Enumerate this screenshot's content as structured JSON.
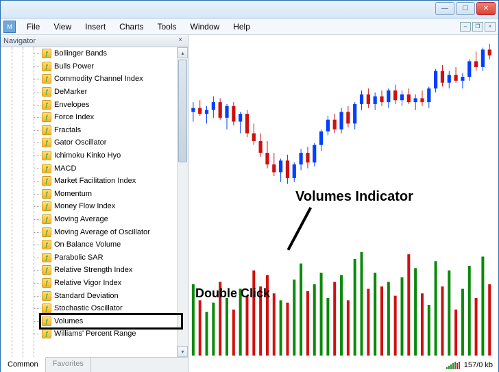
{
  "window": {
    "title": ""
  },
  "menubar": {
    "items": [
      "File",
      "View",
      "Insert",
      "Charts",
      "Tools",
      "Window",
      "Help"
    ]
  },
  "navigator": {
    "title": "Navigator",
    "tabs": {
      "common": "Common",
      "favorites": "Favorites"
    },
    "items": [
      "Bollinger Bands",
      "Bulls Power",
      "Commodity Channel Index",
      "DeMarker",
      "Envelopes",
      "Force Index",
      "Fractals",
      "Gator Oscillator",
      "Ichimoku Kinko Hyo",
      "MACD",
      "Market Facilitation Index",
      "Momentum",
      "Money Flow Index",
      "Moving Average",
      "Moving Average of Oscillator",
      "On Balance Volume",
      "Parabolic SAR",
      "Relative Strength Index",
      "Relative Vigor Index",
      "Standard Deviation",
      "Stochastic Oscillator",
      "Volumes",
      "Williams' Percent Range"
    ],
    "highlighted_item": "Volumes"
  },
  "annotations": {
    "volumes_indicator": "Volumes Indicator",
    "double_click": "Double Click"
  },
  "statusbar": {
    "kb": "157/0 kb"
  },
  "chart_data": {
    "type": "candlestick+bar",
    "candles_y_range": [
      0,
      190
    ],
    "candles": [
      {
        "o": 118,
        "h": 128,
        "l": 108,
        "c": 122,
        "up": true
      },
      {
        "o": 122,
        "h": 130,
        "l": 114,
        "c": 116,
        "up": false
      },
      {
        "o": 116,
        "h": 124,
        "l": 106,
        "c": 120,
        "up": true
      },
      {
        "o": 120,
        "h": 134,
        "l": 112,
        "c": 128,
        "up": true
      },
      {
        "o": 128,
        "h": 132,
        "l": 110,
        "c": 112,
        "up": false
      },
      {
        "o": 112,
        "h": 126,
        "l": 100,
        "c": 124,
        "up": true
      },
      {
        "o": 124,
        "h": 128,
        "l": 104,
        "c": 108,
        "up": false
      },
      {
        "o": 108,
        "h": 118,
        "l": 96,
        "c": 116,
        "up": true
      },
      {
        "o": 116,
        "h": 120,
        "l": 92,
        "c": 96,
        "up": false
      },
      {
        "o": 96,
        "h": 106,
        "l": 84,
        "c": 88,
        "up": false
      },
      {
        "o": 88,
        "h": 96,
        "l": 72,
        "c": 76,
        "up": false
      },
      {
        "o": 76,
        "h": 88,
        "l": 60,
        "c": 64,
        "up": false
      },
      {
        "o": 64,
        "h": 76,
        "l": 52,
        "c": 56,
        "up": false
      },
      {
        "o": 56,
        "h": 70,
        "l": 46,
        "c": 68,
        "up": true
      },
      {
        "o": 68,
        "h": 74,
        "l": 44,
        "c": 50,
        "up": false
      },
      {
        "o": 50,
        "h": 66,
        "l": 46,
        "c": 64,
        "up": true
      },
      {
        "o": 64,
        "h": 80,
        "l": 58,
        "c": 76,
        "up": true
      },
      {
        "o": 76,
        "h": 82,
        "l": 60,
        "c": 66,
        "up": false
      },
      {
        "o": 66,
        "h": 86,
        "l": 62,
        "c": 84,
        "up": true
      },
      {
        "o": 84,
        "h": 100,
        "l": 78,
        "c": 98,
        "up": true
      },
      {
        "o": 98,
        "h": 114,
        "l": 94,
        "c": 110,
        "up": true
      },
      {
        "o": 110,
        "h": 116,
        "l": 96,
        "c": 100,
        "up": false
      },
      {
        "o": 100,
        "h": 122,
        "l": 96,
        "c": 118,
        "up": true
      },
      {
        "o": 118,
        "h": 124,
        "l": 102,
        "c": 106,
        "up": false
      },
      {
        "o": 106,
        "h": 128,
        "l": 100,
        "c": 126,
        "up": true
      },
      {
        "o": 126,
        "h": 140,
        "l": 120,
        "c": 136,
        "up": true
      },
      {
        "o": 136,
        "h": 142,
        "l": 122,
        "c": 126,
        "up": false
      },
      {
        "o": 126,
        "h": 138,
        "l": 120,
        "c": 134,
        "up": true
      },
      {
        "o": 134,
        "h": 140,
        "l": 124,
        "c": 128,
        "up": false
      },
      {
        "o": 128,
        "h": 142,
        "l": 122,
        "c": 140,
        "up": true
      },
      {
        "o": 140,
        "h": 146,
        "l": 126,
        "c": 130,
        "up": false
      },
      {
        "o": 130,
        "h": 140,
        "l": 124,
        "c": 136,
        "up": true
      },
      {
        "o": 136,
        "h": 142,
        "l": 126,
        "c": 128,
        "up": false
      },
      {
        "o": 128,
        "h": 136,
        "l": 120,
        "c": 132,
        "up": true
      },
      {
        "o": 132,
        "h": 140,
        "l": 124,
        "c": 128,
        "up": false
      },
      {
        "o": 128,
        "h": 144,
        "l": 122,
        "c": 142,
        "up": true
      },
      {
        "o": 142,
        "h": 162,
        "l": 138,
        "c": 160,
        "up": true
      },
      {
        "o": 160,
        "h": 166,
        "l": 144,
        "c": 148,
        "up": false
      },
      {
        "o": 148,
        "h": 160,
        "l": 142,
        "c": 156,
        "up": true
      },
      {
        "o": 156,
        "h": 164,
        "l": 148,
        "c": 150,
        "up": false
      },
      {
        "o": 150,
        "h": 158,
        "l": 142,
        "c": 154,
        "up": true
      },
      {
        "o": 154,
        "h": 172,
        "l": 150,
        "c": 170,
        "up": true
      },
      {
        "o": 170,
        "h": 180,
        "l": 160,
        "c": 164,
        "up": false
      },
      {
        "o": 164,
        "h": 184,
        "l": 160,
        "c": 182,
        "up": true
      },
      {
        "o": 182,
        "h": 188,
        "l": 172,
        "c": 176,
        "up": false
      }
    ],
    "volumes_y_range": [
      0,
      100
    ],
    "volumes": [
      {
        "v": 62,
        "up": true
      },
      {
        "v": 48,
        "up": false
      },
      {
        "v": 38,
        "up": true
      },
      {
        "v": 46,
        "up": true
      },
      {
        "v": 64,
        "up": false
      },
      {
        "v": 50,
        "up": true
      },
      {
        "v": 40,
        "up": false
      },
      {
        "v": 58,
        "up": true
      },
      {
        "v": 52,
        "up": false
      },
      {
        "v": 74,
        "up": false
      },
      {
        "v": 60,
        "up": false
      },
      {
        "v": 70,
        "up": false
      },
      {
        "v": 54,
        "up": false
      },
      {
        "v": 48,
        "up": true
      },
      {
        "v": 46,
        "up": false
      },
      {
        "v": 66,
        "up": true
      },
      {
        "v": 80,
        "up": true
      },
      {
        "v": 56,
        "up": false
      },
      {
        "v": 62,
        "up": true
      },
      {
        "v": 72,
        "up": true
      },
      {
        "v": 50,
        "up": true
      },
      {
        "v": 64,
        "up": false
      },
      {
        "v": 70,
        "up": true
      },
      {
        "v": 48,
        "up": false
      },
      {
        "v": 84,
        "up": true
      },
      {
        "v": 90,
        "up": true
      },
      {
        "v": 58,
        "up": false
      },
      {
        "v": 72,
        "up": true
      },
      {
        "v": 60,
        "up": false
      },
      {
        "v": 64,
        "up": true
      },
      {
        "v": 52,
        "up": false
      },
      {
        "v": 68,
        "up": true
      },
      {
        "v": 88,
        "up": false
      },
      {
        "v": 76,
        "up": true
      },
      {
        "v": 54,
        "up": false
      },
      {
        "v": 44,
        "up": true
      },
      {
        "v": 82,
        "up": true
      },
      {
        "v": 60,
        "up": false
      },
      {
        "v": 74,
        "up": true
      },
      {
        "v": 40,
        "up": false
      },
      {
        "v": 58,
        "up": true
      },
      {
        "v": 78,
        "up": true
      },
      {
        "v": 50,
        "up": false
      },
      {
        "v": 86,
        "up": true
      },
      {
        "v": 62,
        "up": false
      }
    ]
  }
}
